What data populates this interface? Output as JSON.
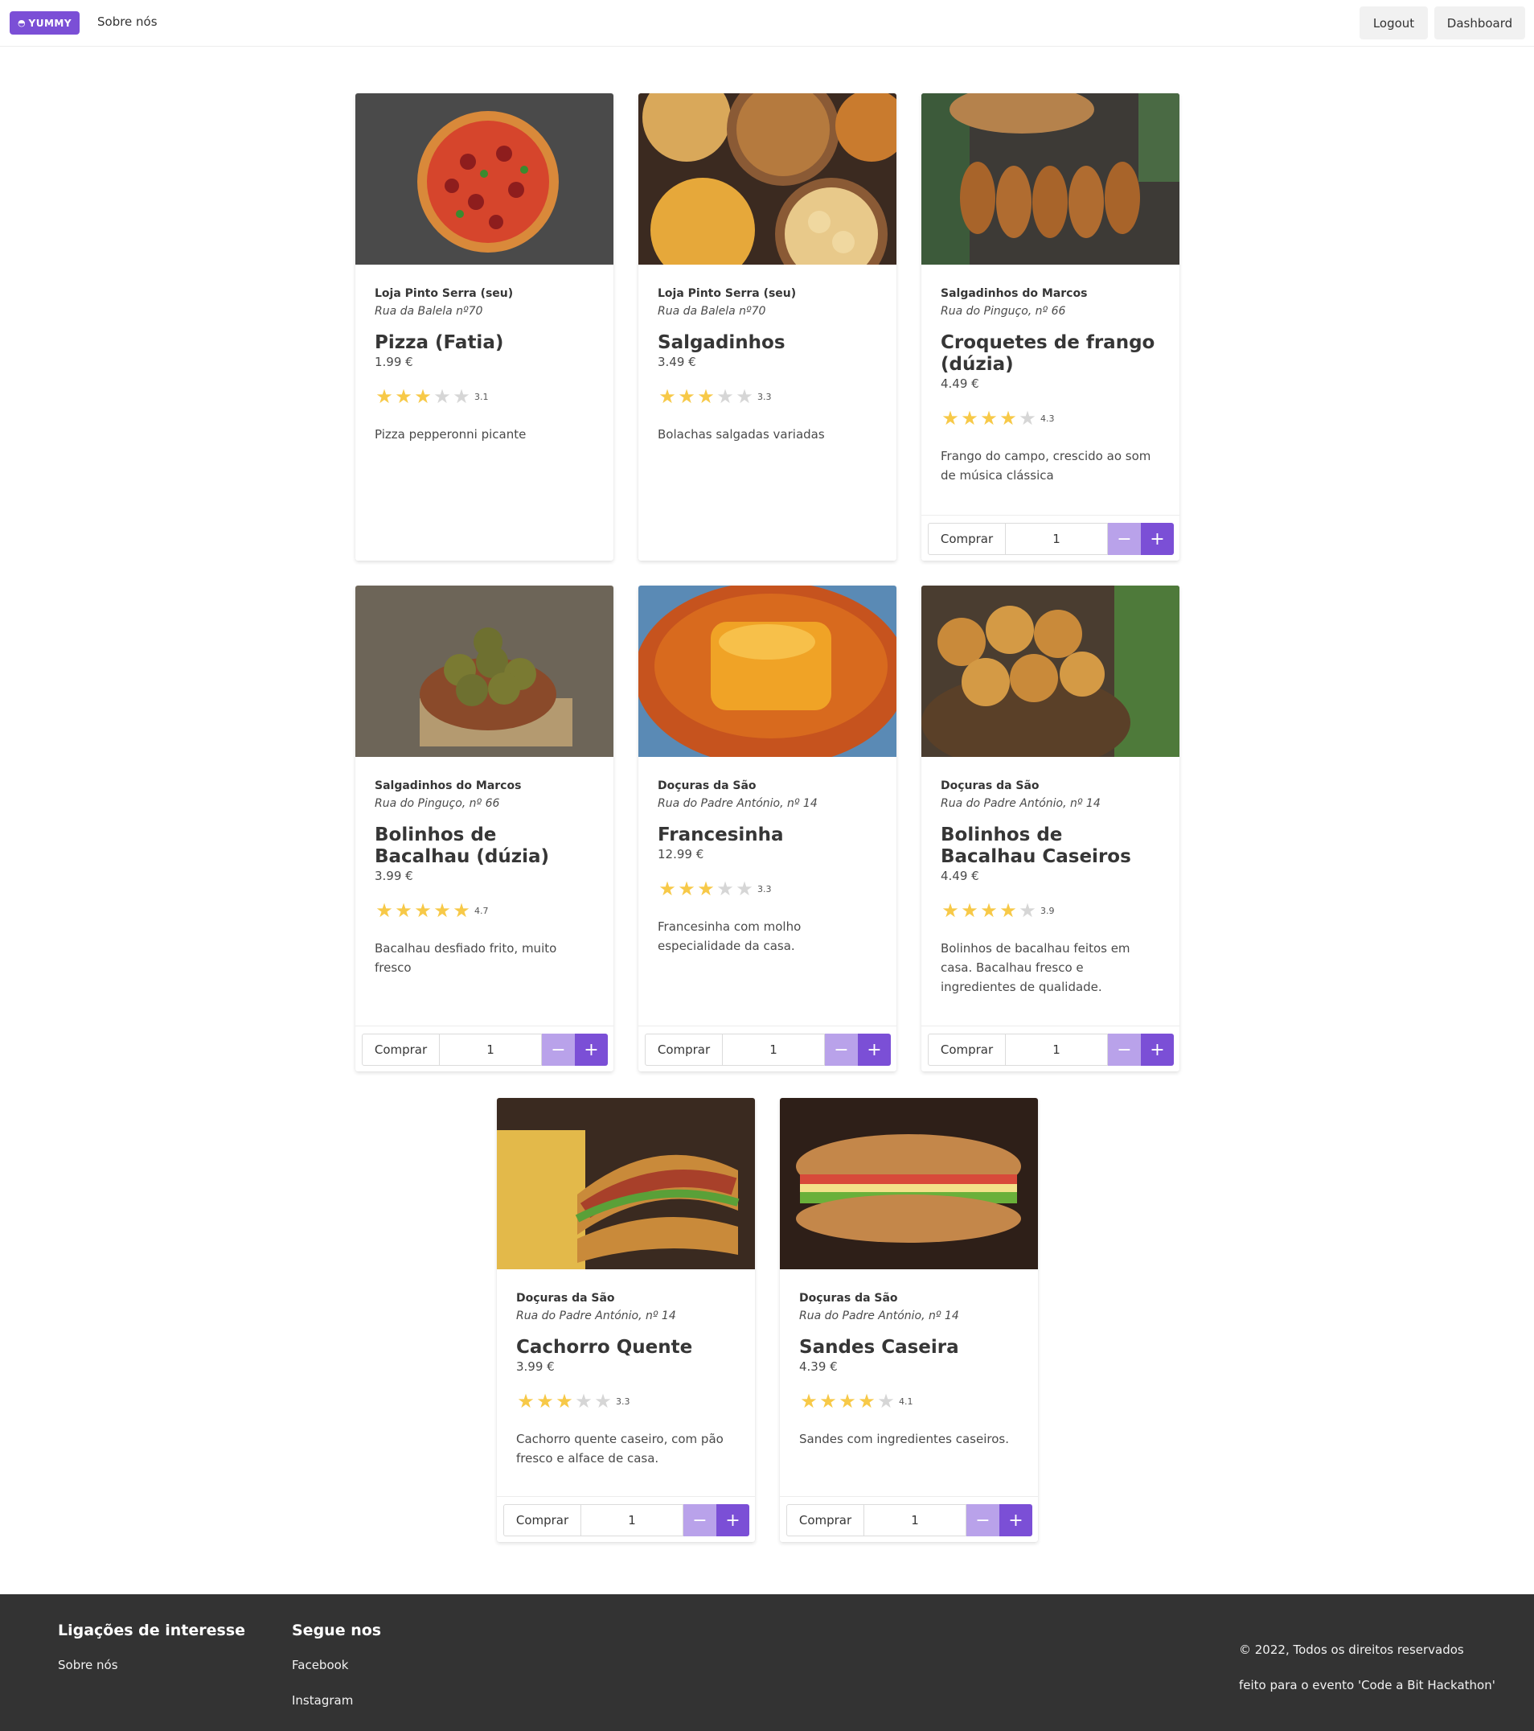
{
  "navbar": {
    "logo_text": "YUMMY",
    "about_link": "Sobre nós",
    "logout_label": "Logout",
    "dashboard_label": "Dashboard"
  },
  "colors": {
    "accent": "#7b4fd6",
    "accent_light": "#b9a2ea",
    "star": "#f7c948",
    "footer_bg": "#333333"
  },
  "cards": [
    {
      "shop": "Loja Pinto Serra (seu)",
      "address": "Rua da Balela nº70",
      "name": "Pizza (Fatia)",
      "price": "1.99 €",
      "rating": 3.1,
      "rating_label": "3.1",
      "stars_filled": 3,
      "description": "Pizza pepperonni picante",
      "has_buy": false
    },
    {
      "shop": "Loja Pinto Serra (seu)",
      "address": "Rua da Balela nº70",
      "name": "Salgadinhos",
      "price": "3.49 €",
      "rating": 3.3,
      "rating_label": "3.3",
      "stars_filled": 3,
      "description": "Bolachas salgadas variadas",
      "has_buy": false
    },
    {
      "shop": "Salgadinhos do Marcos",
      "address": "Rua do Pinguço, nº 66",
      "name": "Croquetes de frango (dúzia)",
      "price": "4.49 €",
      "rating": 4.3,
      "rating_label": "4.3",
      "stars_filled": 4,
      "description": "Frango do campo, crescido ao som de música clássica",
      "has_buy": true
    },
    {
      "shop": "Salgadinhos do Marcos",
      "address": "Rua do Pinguço, nº 66",
      "name": "Bolinhos de Bacalhau (dúzia)",
      "price": "3.99 €",
      "rating": 4.7,
      "rating_label": "4.7",
      "stars_filled": 5,
      "description": "Bacalhau desfiado frito, muito fresco",
      "has_buy": true
    },
    {
      "shop": "Doçuras da São",
      "address": "Rua do Padre António, nº 14",
      "name": "Francesinha",
      "price": "12.99 €",
      "rating": 3.3,
      "rating_label": "3.3",
      "stars_filled": 3,
      "description": "Francesinha com molho especialidade da casa.",
      "has_buy": true
    },
    {
      "shop": "Doçuras da São",
      "address": "Rua do Padre António, nº 14",
      "name": "Bolinhos de Bacalhau Caseiros",
      "price": "4.49 €",
      "rating": 3.9,
      "rating_label": "3.9",
      "stars_filled": 4,
      "description": "Bolinhos de bacalhau feitos em casa. Bacalhau fresco e ingredientes de qualidade.",
      "has_buy": true
    },
    {
      "shop": "Doçuras da São",
      "address": "Rua do Padre António, nº 14",
      "name": "Cachorro Quente",
      "price": "3.99 €",
      "rating": 3.3,
      "rating_label": "3.3",
      "stars_filled": 3,
      "description": "Cachorro quente caseiro, com pão fresco e alface de casa.",
      "has_buy": true
    },
    {
      "shop": "Doçuras da São",
      "address": "Rua do Padre António, nº 14",
      "name": "Sandes Caseira",
      "price": "4.39 €",
      "rating": 4.1,
      "rating_label": "4.1",
      "stars_filled": 4,
      "description": "Sandes com ingredientes caseiros.",
      "has_buy": true
    }
  ],
  "buy": {
    "button_label": "Comprar",
    "quantity": "1",
    "minus_label": "−",
    "plus_label": "+"
  },
  "footer": {
    "links_heading": "Ligações de interesse",
    "about_link": "Sobre nós",
    "follow_heading": "Segue nos",
    "facebook_link": "Facebook",
    "instagram_link": "Instagram",
    "copyright": "© 2022, Todos os direitos reservados",
    "event_note": "feito para o evento 'Code a Bit Hackathon'"
  }
}
